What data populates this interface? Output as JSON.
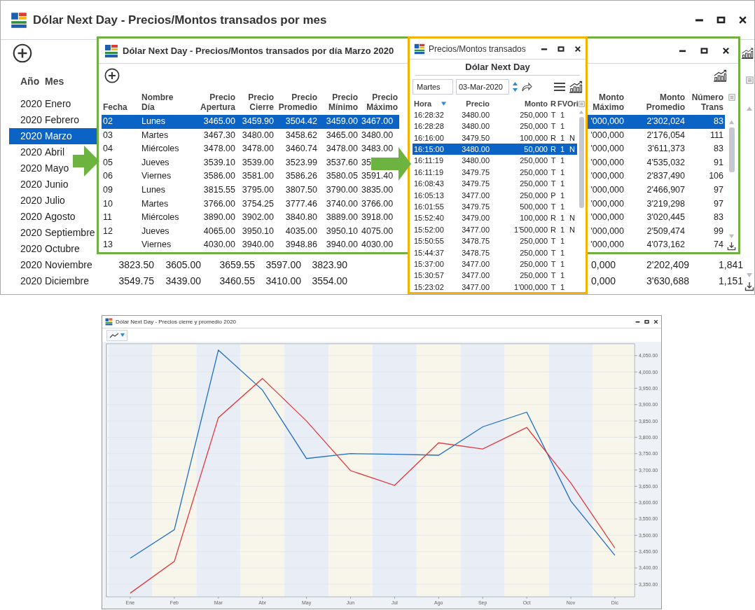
{
  "main_window": {
    "title": "Dólar Next Day - Precios/Montos transados por mes",
    "table": {
      "columns": [
        "Año",
        "Mes"
      ],
      "rows": [
        {
          "year": "2020",
          "month": "Enero",
          "selected": false
        },
        {
          "year": "2020",
          "month": "Febrero",
          "selected": false
        },
        {
          "year": "2020",
          "month": "Marzo",
          "selected": true
        },
        {
          "year": "2020",
          "month": "Abril",
          "selected": false
        },
        {
          "year": "2020",
          "month": "Mayo",
          "selected": false
        },
        {
          "year": "2020",
          "month": "Junio",
          "selected": false
        },
        {
          "year": "2020",
          "month": "Julio",
          "selected": false
        },
        {
          "year": "2020",
          "month": "Agosto",
          "selected": false
        },
        {
          "year": "2020",
          "month": "Septiembre",
          "selected": false
        },
        {
          "year": "2020",
          "month": "Octubre",
          "selected": false
        },
        {
          "year": "2020",
          "month": "Noviembre",
          "selected": false,
          "column_3": "3823.50",
          "column_4": "3605.00",
          "column_5": "3659.55",
          "column_6": "3597.00",
          "column_7": "3823.90",
          "column_8": "0,000",
          "column_9": "2'202,409",
          "column_10": "1,841"
        },
        {
          "year": "2020",
          "month": "Diciembre",
          "selected": false,
          "column_3": "3549.75",
          "column_4": "3439.00",
          "column_5": "3460.55",
          "column_6": "3410.00",
          "column_7": "3554.00",
          "column_8": "0,000",
          "column_9": "3'630,688",
          "column_10": "1,151"
        }
      ]
    }
  },
  "daily_window": {
    "title": "Dólar Next Day - Precios/Montos transados por día Marzo 2020",
    "table": {
      "columns": [
        "Fecha",
        "Nombre Día",
        "Precio Apertura",
        "Precio Cierre",
        "Precio Promedio",
        "Precio Mínimo",
        "Precio Máximo",
        "Monto Máximo",
        "Monto Promedio",
        "Número Trans"
      ],
      "rows": [
        {
          "cells": [
            "02",
            "Lunes",
            "3465.00",
            "3459.90",
            "3504.42",
            "3459.00",
            "3467.00",
            "'000,000",
            "2'302,024",
            "83"
          ],
          "selected": true
        },
        {
          "cells": [
            "03",
            "Martes",
            "3467.30",
            "3480.00",
            "3458.62",
            "3465.00",
            "3480.00",
            "'000,000",
            "2'176,054",
            "111"
          ],
          "selected": false
        },
        {
          "cells": [
            "04",
            "Miércoles",
            "3478.00",
            "3478.00",
            "3460.74",
            "3478.00",
            "3483.00",
            "'000,000",
            "3'611,373",
            "83"
          ],
          "selected": false
        },
        {
          "cells": [
            "05",
            "Jueves",
            "3539.10",
            "3539.00",
            "3523.99",
            "3537.60",
            "35",
            "'000,000",
            "4'535,032",
            "91"
          ],
          "selected": false
        },
        {
          "cells": [
            "06",
            "Viernes",
            "3586.00",
            "3581.00",
            "3586.26",
            "3580.05",
            "3591.40",
            "'000,000",
            "2'837,490",
            "106"
          ],
          "selected": false
        },
        {
          "cells": [
            "09",
            "Lunes",
            "3815.55",
            "3795.00",
            "3807.50",
            "3790.00",
            "3835.00",
            "'000,000",
            "2'466,907",
            "97"
          ],
          "selected": false
        },
        {
          "cells": [
            "10",
            "Martes",
            "3766.00",
            "3754.25",
            "3777.46",
            "3740.00",
            "3766.00",
            "'000,000",
            "3'219,298",
            "97"
          ],
          "selected": false
        },
        {
          "cells": [
            "11",
            "Miércoles",
            "3890.00",
            "3902.00",
            "3840.80",
            "3889.00",
            "3918.00",
            "'000,000",
            "3'020,445",
            "83"
          ],
          "selected": false
        },
        {
          "cells": [
            "12",
            "Jueves",
            "4065.00",
            "3950.10",
            "4035.00",
            "3950.10",
            "4075.00",
            "'000,000",
            "2'509,474",
            "99"
          ],
          "selected": false
        },
        {
          "cells": [
            "13",
            "Viernes",
            "4030.00",
            "3940.00",
            "3948.86",
            "3940.00",
            "4030.00",
            "'000,000",
            "4'073,162",
            "74"
          ],
          "selected": false
        }
      ]
    }
  },
  "trades_window": {
    "title": "Precios/Montos transados",
    "subtitle": "Dólar Next Day",
    "day_field": "Martes",
    "date_field": "03-Mar-2020",
    "table": {
      "columns": [
        "Hora",
        "Precio",
        "Monto",
        "R",
        "FV",
        "Ori"
      ],
      "rows": [
        {
          "cells": [
            "16:28:32",
            "3480.00",
            "250,000",
            "T",
            "1"
          ],
          "selected": false
        },
        {
          "cells": [
            "16:28:28",
            "3480.00",
            "250,000",
            "T",
            "1"
          ],
          "selected": false
        },
        {
          "cells": [
            "16:16:00",
            "3479.50",
            "100,000",
            "R",
            "1",
            "N"
          ],
          "selected": false
        },
        {
          "cells": [
            "16:15:00",
            "3480.00",
            "50,000",
            "R",
            "1",
            "N"
          ],
          "selected": true
        },
        {
          "cells": [
            "16:11:19",
            "3480.00",
            "250,000",
            "T",
            "1"
          ],
          "selected": false
        },
        {
          "cells": [
            "16:11:19",
            "3479.75",
            "250,000",
            "T",
            "1"
          ],
          "selected": false
        },
        {
          "cells": [
            "16:08:43",
            "3479.75",
            "250,000",
            "T",
            "1"
          ],
          "selected": false
        },
        {
          "cells": [
            "16:05:13",
            "3477.00",
            "250,000",
            "P",
            "1"
          ],
          "selected": false
        },
        {
          "cells": [
            "16:01:55",
            "3479.75",
            "500,000",
            "T",
            "1"
          ],
          "selected": false
        },
        {
          "cells": [
            "15:52:40",
            "3479.00",
            "100,000",
            "R",
            "1",
            "N"
          ],
          "selected": false
        },
        {
          "cells": [
            "15:52:00",
            "3477.00",
            "1'500,000",
            "R",
            "1",
            "N"
          ],
          "selected": false
        },
        {
          "cells": [
            "15:50:55",
            "3478.75",
            "250,000",
            "T",
            "1"
          ],
          "selected": false
        },
        {
          "cells": [
            "15:44:37",
            "3478.75",
            "250,000",
            "T",
            "1"
          ],
          "selected": false
        },
        {
          "cells": [
            "15:37:00",
            "3477.00",
            "250,000",
            "T",
            "1"
          ],
          "selected": false
        },
        {
          "cells": [
            "15:30:57",
            "3477.00",
            "250,000",
            "T",
            "1"
          ],
          "selected": false
        },
        {
          "cells": [
            "15:23:02",
            "3477.00",
            "1'000,000",
            "T",
            "1"
          ],
          "selected": false
        }
      ]
    }
  },
  "chart_window": {
    "title": "Dólar Next Day - Precios cierre y promedio 2020",
    "chart_data": {
      "type": "line",
      "categories": [
        "Ene",
        "Feb",
        "Mar",
        "Abr",
        "May",
        "Jun",
        "Jul",
        "Ago",
        "Sep",
        "Oct",
        "Nov",
        "Dic"
      ],
      "series": [
        {
          "color": "#1f6fc5",
          "values": [
            3430,
            3517,
            4067,
            3945,
            3735,
            3750,
            3748,
            3745,
            3832,
            3877,
            3605,
            3439
          ]
        },
        {
          "color": "#e0393e",
          "values": [
            3323,
            3420,
            3860,
            3980,
            3850,
            3698,
            3653,
            3783,
            3764,
            3830,
            3660,
            3461
          ]
        }
      ],
      "ylim": [
        3312,
        4086
      ],
      "grid": true,
      "yticks": [
        {
          "value": 3350,
          "label": "3,350.00"
        },
        {
          "value": 3400,
          "label": "3,400.00"
        },
        {
          "value": 3450,
          "label": "3,450.00"
        },
        {
          "value": 3500,
          "label": "3,500.00"
        },
        {
          "value": 3550,
          "label": "3,550.00"
        },
        {
          "value": 3600,
          "label": "3,600.00"
        },
        {
          "value": 3650,
          "label": "3,650.00"
        },
        {
          "value": 3700,
          "label": "3,700.00"
        },
        {
          "value": 3750,
          "label": "3,750.00"
        },
        {
          "value": 3800,
          "label": "3,800.00"
        },
        {
          "value": 3850,
          "label": "3,850.00"
        },
        {
          "value": 3900,
          "label": "3,900.00"
        },
        {
          "value": 3950,
          "label": "3,950.00"
        },
        {
          "value": 4000,
          "label": "4,000.00"
        },
        {
          "value": 4050,
          "label": "4,050.00"
        }
      ]
    }
  }
}
